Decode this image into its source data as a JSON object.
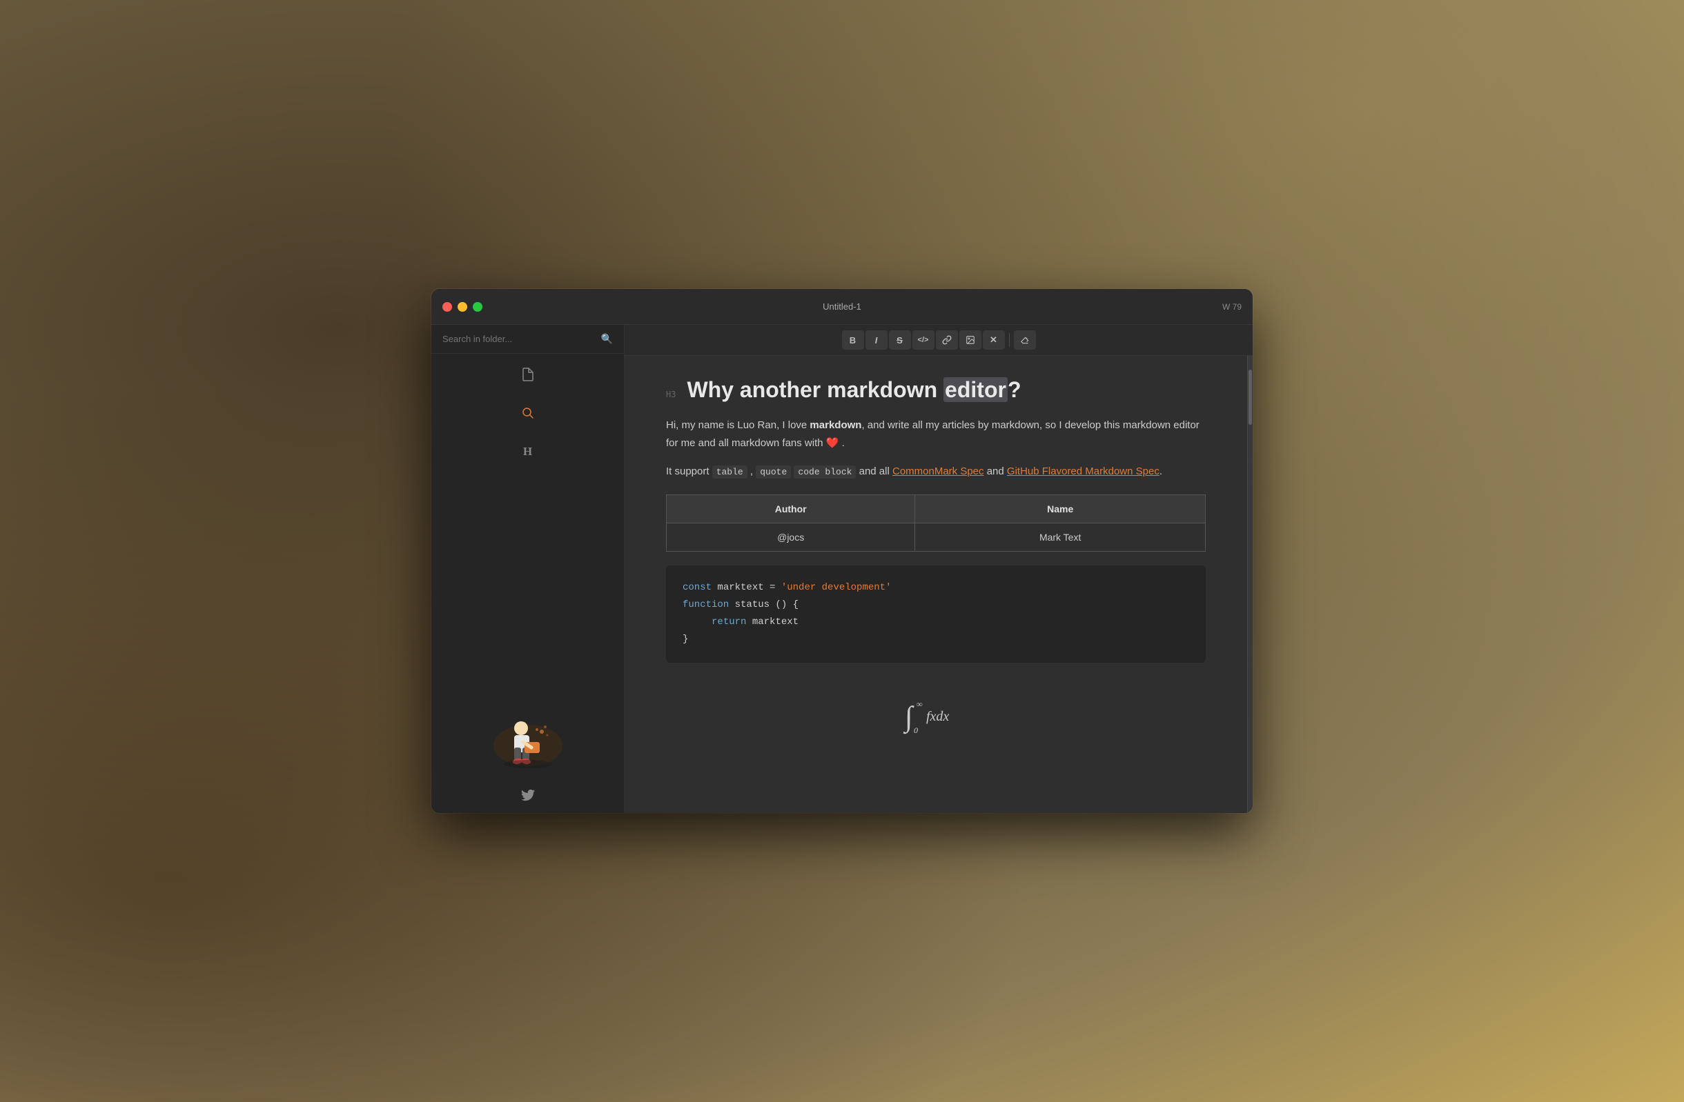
{
  "window": {
    "title": "Untitled-1",
    "word_count_label": "W 79"
  },
  "sidebar": {
    "search_placeholder": "Search in folder...",
    "icons": [
      {
        "name": "file-icon",
        "symbol": "🗋",
        "active": false
      },
      {
        "name": "search-icon",
        "symbol": "⌕",
        "active": true
      },
      {
        "name": "heading-icon",
        "symbol": "H",
        "active": false
      }
    ],
    "twitter_label": "🐦"
  },
  "toolbar": {
    "buttons": [
      {
        "name": "bold-button",
        "label": "B"
      },
      {
        "name": "italic-button",
        "label": "I"
      },
      {
        "name": "strikethrough-button",
        "label": "S"
      },
      {
        "name": "code-button",
        "label": "</>"
      },
      {
        "name": "link-button",
        "label": "🔗"
      },
      {
        "name": "image-button",
        "label": "⊞"
      },
      {
        "name": "clear-button",
        "label": "✕"
      },
      {
        "name": "erase-button",
        "label": "◇"
      }
    ]
  },
  "editor": {
    "heading_level": "H3",
    "heading": "Why another markdown editor?",
    "heading_highlight_word": "editor",
    "paragraph1_before": "Hi, my name is Luo Ran, I love ",
    "paragraph1_bold": "markdown",
    "paragraph1_after": ", and write all my articles by markdown, so I develop this markdown editor for me and all markdown fans with ❤️ .",
    "paragraph2_before": "It support ",
    "paragraph2_code1": "table",
    "paragraph2_sep1": " ,",
    "paragraph2_code2": "quote",
    "paragraph2_code3": "code block",
    "paragraph2_middle": " and all ",
    "paragraph2_link1": "CommonMark Spec",
    "paragraph2_between": " and ",
    "paragraph2_link2": "GitHub Flavored Markdown Spec",
    "paragraph2_end": ".",
    "table": {
      "headers": [
        "Author",
        "Name"
      ],
      "rows": [
        [
          "@jocs",
          "Mark Text"
        ]
      ]
    },
    "code_lines": [
      {
        "parts": [
          {
            "type": "const",
            "text": "const"
          },
          {
            "type": "var",
            "text": " marktext = "
          },
          {
            "type": "string",
            "text": "'under development'"
          }
        ]
      },
      {
        "parts": [
          {
            "type": "keyword",
            "text": "function"
          },
          {
            "type": "var",
            "text": " status () {"
          }
        ]
      },
      {
        "parts": [
          {
            "type": "indent",
            "text": "    "
          },
          {
            "type": "return",
            "text": "return"
          },
          {
            "type": "var",
            "text": " marktext"
          }
        ]
      },
      {
        "parts": [
          {
            "type": "var",
            "text": "}"
          }
        ]
      }
    ],
    "math_expression": "∫₀^∞ fxdx"
  }
}
